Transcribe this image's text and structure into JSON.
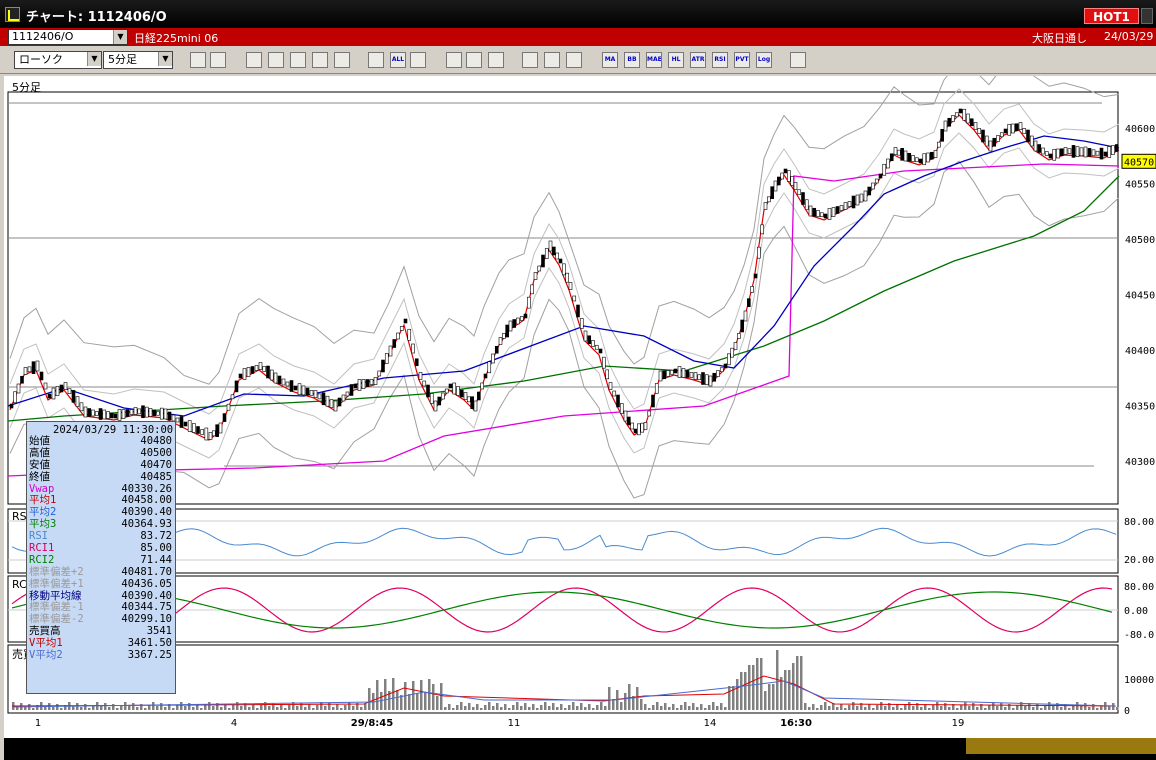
{
  "window": {
    "title": "チャート: 1112406/O",
    "hot_label": "HOT1"
  },
  "header": {
    "symbol": "1112406/O",
    "name": "日経225mini 06",
    "market": "大阪日通し",
    "date": "24/03/29"
  },
  "toolbar": {
    "chart_type": "ローソク",
    "interval": "5分足",
    "buttons": [
      "zoom",
      "draw",
      "drawing",
      "lines",
      "price",
      "compare",
      "add",
      "remove",
      "ALL",
      "pen",
      "cursor",
      "arrow",
      "tools",
      "settings",
      "color",
      "stats",
      "MA",
      "BB",
      "MAE",
      "HL",
      "ATR",
      "RSI",
      "PVT",
      "Log",
      "export"
    ]
  },
  "chart": {
    "panel_label": "5分足",
    "current_price_tag": "40570",
    "price_axis": [
      "40600",
      "40550",
      "40500",
      "40450",
      "40400",
      "40350",
      "40300"
    ],
    "rsi_label": "RSI",
    "rsi_axis": [
      "80.00",
      "20.00"
    ],
    "rci_label": "RCI",
    "rci_axis": [
      "80.00",
      "0.00",
      "-80.0"
    ],
    "volume_label": "売買高",
    "volume_axis": [
      "10000",
      "0"
    ],
    "x_labels": [
      "1",
      "4",
      "29/8:45",
      "11",
      "14",
      "16:30",
      "19"
    ]
  },
  "infobox": {
    "datetime": "2024/03/29  11:30:00",
    "rows": [
      {
        "k": "始値",
        "v": "40480",
        "c": "#000"
      },
      {
        "k": "高値",
        "v": "40500",
        "c": "#000"
      },
      {
        "k": "安値",
        "v": "40470",
        "c": "#000"
      },
      {
        "k": "終値",
        "v": "40485",
        "c": "#000"
      },
      {
        "k": "Vwap",
        "v": "40330.26",
        "c": "#d000d0"
      },
      {
        "k": "平均1",
        "v": "40458.00",
        "c": "#c00000"
      },
      {
        "k": "平均2",
        "v": "40390.40",
        "c": "#2060d0"
      },
      {
        "k": "平均3",
        "v": "40364.93",
        "c": "#008000"
      },
      {
        "k": "RSI",
        "v": "83.72",
        "c": "#4a8ad0"
      },
      {
        "k": "RCI1",
        "v": "85.00",
        "c": "#d00060"
      },
      {
        "k": "RCI2",
        "v": "71.44",
        "c": "#008000"
      },
      {
        "k": "標準偏差+2",
        "v": "40481.70",
        "c": "#999"
      },
      {
        "k": "標準偏差+1",
        "v": "40436.05",
        "c": "#999"
      },
      {
        "k": "移動平均線",
        "v": "40390.40",
        "c": "#000080"
      },
      {
        "k": "標準偏差-1",
        "v": "40344.75",
        "c": "#999"
      },
      {
        "k": "標準偏差-2",
        "v": "40299.10",
        "c": "#999"
      },
      {
        "k": "売買高",
        "v": "3541",
        "c": "#000"
      },
      {
        "k": "V平均1",
        "v": "3461.50",
        "c": "#c00000"
      },
      {
        "k": "V平均2",
        "v": "3367.25",
        "c": "#4a6ad0"
      }
    ]
  },
  "colors": {
    "candle_up": "#ffffff",
    "candle_down": "#000000",
    "ma1": "#e00000",
    "ma2": "#0000c0",
    "ma3": "#007000",
    "vwap": "#e000e0",
    "bands": "#a0a0a0",
    "rsi": "#4a8ad0",
    "rci1": "#e00060",
    "rci2": "#008000"
  }
}
